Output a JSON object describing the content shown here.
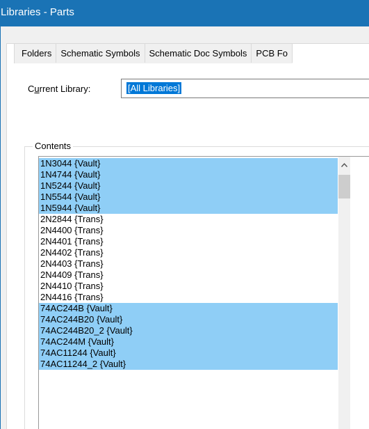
{
  "window": {
    "title": "Libraries - Parts",
    "title_bar_color": "#1a73b5"
  },
  "tabs": [
    {
      "label": "Folders"
    },
    {
      "label": "Schematic Symbols"
    },
    {
      "label": "Schematic Doc Symbols"
    },
    {
      "label": "PCB Fo"
    }
  ],
  "current_library": {
    "label_pre": "C",
    "label_underlined": "u",
    "label_post": "rrent Library:",
    "value": "[All Libraries]"
  },
  "contents": {
    "legend": "Contents",
    "selection_color": "#8fcef6",
    "items": [
      {
        "text": "1N3044 {Vault}",
        "selected": true
      },
      {
        "text": "1N4744 {Vault}",
        "selected": true
      },
      {
        "text": "1N5244 {Vault}",
        "selected": true
      },
      {
        "text": "1N5544 {Vault}",
        "selected": true
      },
      {
        "text": "1N5944 {Vault}",
        "selected": true
      },
      {
        "text": "2N2844 {Trans}",
        "selected": false
      },
      {
        "text": "2N4400 {Trans}",
        "selected": false
      },
      {
        "text": "2N4401 {Trans}",
        "selected": false
      },
      {
        "text": "2N4402 {Trans}",
        "selected": false
      },
      {
        "text": "2N4403 {Trans}",
        "selected": false
      },
      {
        "text": "2N4409 {Trans}",
        "selected": false
      },
      {
        "text": "2N4410 {Trans}",
        "selected": false
      },
      {
        "text": "2N4416 {Trans}",
        "selected": false
      },
      {
        "text": "74AC244B {Vault}",
        "selected": true
      },
      {
        "text": "74AC244B20 {Vault}",
        "selected": true
      },
      {
        "text": "74AC244B20_2 {Vault}",
        "selected": true
      },
      {
        "text": "74AC244M {Vault}",
        "selected": true
      },
      {
        "text": "74AC11244 {Vault}",
        "selected": true
      },
      {
        "text": "74AC11244_2 {Vault}",
        "selected": true
      }
    ]
  },
  "scrollbar": {
    "up_icon": "chevron-up-icon"
  }
}
